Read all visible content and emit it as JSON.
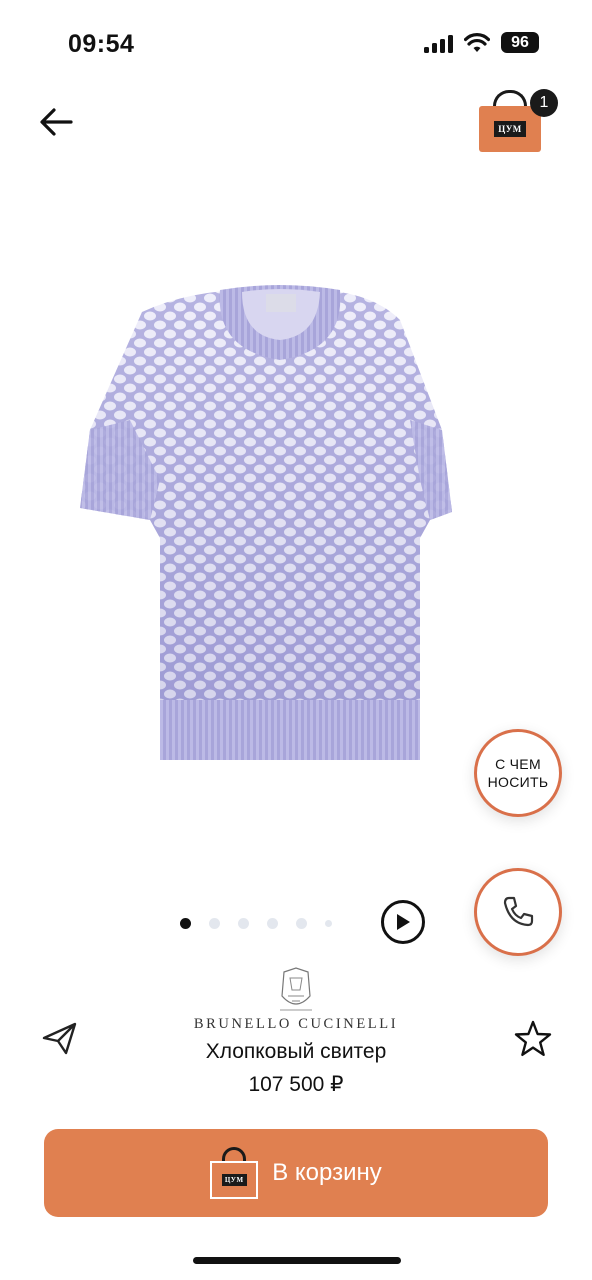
{
  "status_bar": {
    "time": "09:54",
    "battery": "96"
  },
  "header": {
    "cart_logo": "ЦУМ",
    "cart_count": "1"
  },
  "product": {
    "brand": "BRUNELLO CUCINELLI",
    "name": "Хлопковый свитер",
    "price": "107 500 ₽",
    "image_colors": {
      "knit": "#b7b5e3",
      "knit_dark": "#8f8cc8",
      "label": "#dcdce8"
    }
  },
  "floating": {
    "wear_with": "С ЧЕМ\nНОСИТЬ"
  },
  "carousel": {
    "count": 6,
    "active_index": 0
  },
  "add_to_cart": {
    "label": "В корзину",
    "logo": "ЦУМ"
  },
  "colors": {
    "accent": "#e08050",
    "accent_border": "#d9704a"
  }
}
